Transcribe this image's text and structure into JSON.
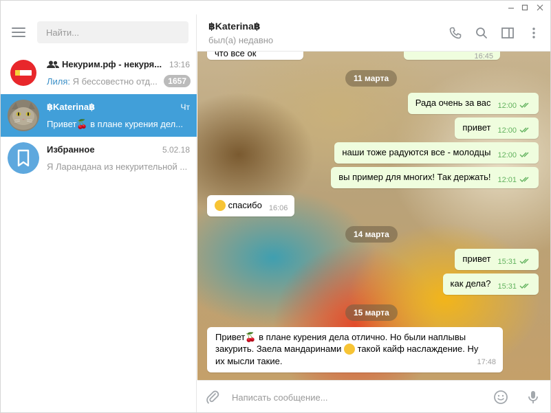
{
  "window": {
    "minimize": "–",
    "maximize": "☐",
    "close": "✕"
  },
  "sidebar": {
    "search_placeholder": "Найти...",
    "dialogs": [
      {
        "name": "Некурим.рф - некуря...",
        "time": "13:16",
        "sender": "Лиля:",
        "preview": " Я бессовестно отд...",
        "unread": "1657",
        "avatar": "no-smoking-icon",
        "group": true
      },
      {
        "name": "฿Katerina฿",
        "time": "Чт",
        "preview": "Привет🍒 в плане курения дел...",
        "avatar": "cat-photo",
        "active": true
      },
      {
        "name": "Избранное",
        "time": "5.02.18",
        "preview": "Я Ларандана из некурительной ...",
        "avatar": "bookmark-icon"
      }
    ]
  },
  "chat": {
    "title": "฿Katerina฿",
    "status": "был(а) недавно",
    "composer_placeholder": "Написать сообщение...",
    "partial_top": {
      "text": "что все ок",
      "time": "16:45"
    },
    "dates": [
      "11 марта",
      "14 марта",
      "15 марта"
    ],
    "messages_11": [
      {
        "text": "Рада очень за вас",
        "time": "12:00"
      },
      {
        "text": "привет",
        "time": "12:00"
      },
      {
        "text": "наши тоже радуются все - молодцы",
        "time": "12:00"
      },
      {
        "text": "вы пример для многих! Так держать!",
        "time": "12:01"
      }
    ],
    "reply_11": {
      "text": "спасибо",
      "time": "16:06"
    },
    "messages_14": [
      {
        "text": "привет",
        "time": "15:31"
      },
      {
        "text": "как дела?",
        "time": "15:31"
      }
    ],
    "incoming_15": {
      "line1_a": "Привет",
      "line1_b": " в плане курения дела отлично. Но были наплывы",
      "line2_a": "закурить. Заела мандаринами ",
      "line2_b": "  такой кайф наслаждение. Ну",
      "line3": "их мысли такие.",
      "time": "17:48"
    }
  },
  "colors": {
    "accent": "#419fd9",
    "outgoing": "#effdde",
    "check": "#62b25e",
    "badge": "#bbbbbb"
  }
}
